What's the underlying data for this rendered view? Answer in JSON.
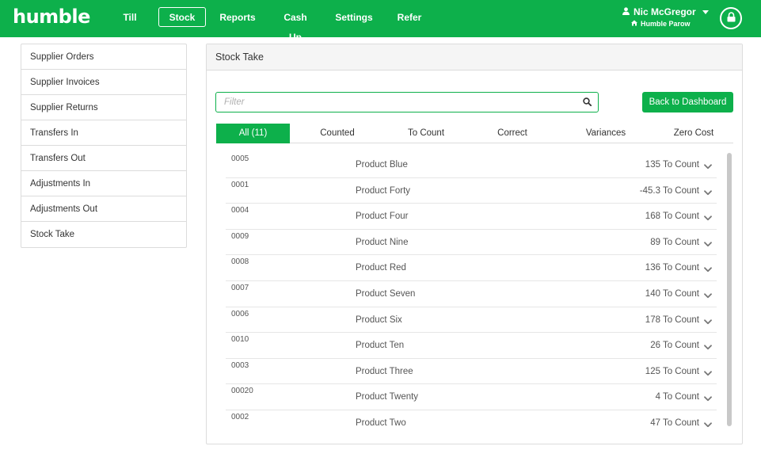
{
  "app": {
    "logo": "humble"
  },
  "nav": {
    "items": [
      {
        "label": "Till"
      },
      {
        "label": "Stock",
        "active": true
      },
      {
        "label": "Reports"
      },
      {
        "label": "Cash Up"
      },
      {
        "label": "Settings"
      },
      {
        "label": "Refer"
      }
    ]
  },
  "user": {
    "name": "Nic McGregor",
    "store": "Humble Parow"
  },
  "sidebar": {
    "items": [
      {
        "label": "Supplier Orders"
      },
      {
        "label": "Supplier Invoices"
      },
      {
        "label": "Supplier Returns"
      },
      {
        "label": "Transfers In"
      },
      {
        "label": "Transfers Out"
      },
      {
        "label": "Adjustments In"
      },
      {
        "label": "Adjustments Out"
      },
      {
        "label": "Stock Take"
      }
    ]
  },
  "panel": {
    "title": "Stock Take",
    "filter_placeholder": "Filter",
    "filter_value": "",
    "back_button": "Back to Dashboard",
    "tabs": [
      {
        "label": "All (11)",
        "active": true
      },
      {
        "label": "Counted"
      },
      {
        "label": "To Count"
      },
      {
        "label": "Correct"
      },
      {
        "label": "Variances"
      },
      {
        "label": "Zero Cost"
      }
    ],
    "rows": [
      {
        "code": "0005",
        "name": "Product Blue",
        "count": "135 To Count"
      },
      {
        "code": "0001",
        "name": "Product Forty",
        "count": "-45.3 To Count"
      },
      {
        "code": "0004",
        "name": "Product Four",
        "count": "168 To Count"
      },
      {
        "code": "0009",
        "name": "Product Nine",
        "count": "89 To Count"
      },
      {
        "code": "0008",
        "name": "Product Red",
        "count": "136 To Count"
      },
      {
        "code": "0007",
        "name": "Product Seven",
        "count": "140 To Count"
      },
      {
        "code": "0006",
        "name": "Product Six",
        "count": "178 To Count"
      },
      {
        "code": "0010",
        "name": "Product Ten",
        "count": "26 To Count"
      },
      {
        "code": "0003",
        "name": "Product Three",
        "count": "125 To Count"
      },
      {
        "code": "00020",
        "name": "Product Twenty",
        "count": "4 To Count"
      },
      {
        "code": "0002",
        "name": "Product Two",
        "count": "47 To Count"
      }
    ]
  },
  "colors": {
    "brand": "#0db04b",
    "border": "#dcdcdc"
  },
  "icons": {
    "user": "user-icon",
    "home": "home-icon",
    "lock": "lock-icon",
    "search": "search-icon",
    "chevron": "chevron-down-icon"
  }
}
